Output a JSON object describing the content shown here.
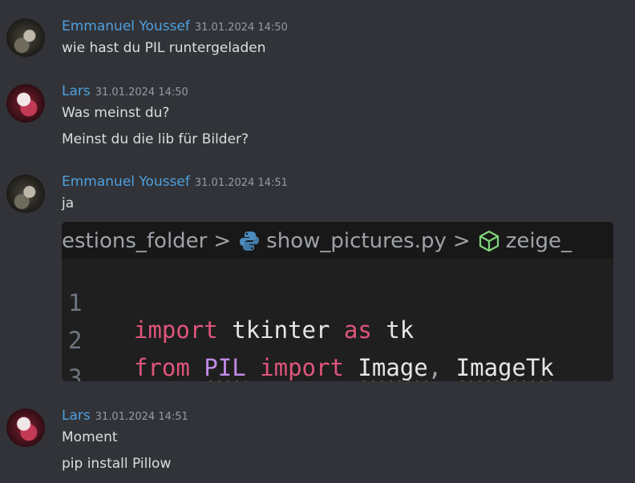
{
  "messages": [
    {
      "author": "Emmanuel Youssef",
      "time": "31.01.2024 14:50",
      "lines": [
        "wie hast du PIL runtergeladen"
      ]
    },
    {
      "author": "Lars",
      "time": "31.01.2024 14:50",
      "lines": [
        "Was meinst du?",
        "Meinst du die lib für Bilder?"
      ]
    },
    {
      "author": "Emmanuel Youssef",
      "time": "31.01.2024 14:51",
      "lines": [
        "ja"
      ]
    },
    {
      "author": "Lars",
      "time": "31.01.2024 14:51",
      "lines": [
        "Moment",
        "pip install Pillow"
      ]
    }
  ],
  "attachment": {
    "breadcrumb": {
      "folder": "estions_folder",
      "separator": ">",
      "file": "show_pictures.py",
      "symbol": "zeige_"
    },
    "code": [
      {
        "num": "1",
        "tokens": [
          "import",
          "tkinter",
          "as",
          "tk"
        ]
      },
      {
        "num": "2",
        "tokens": [
          "from",
          "PIL",
          "import",
          "Image",
          ",",
          "ImageTk"
        ]
      },
      {
        "num": "3",
        "tokens": []
      }
    ],
    "icons": {
      "python": "python-file-icon",
      "symbol": "cube-symbol-icon"
    }
  },
  "colors": {
    "background": "#313338",
    "author": "#4fa0e0",
    "timestamp": "#949ba4",
    "message_text": "#dbdee1",
    "keyword": "#e0557c",
    "module_highlight": "#c08ae6"
  }
}
